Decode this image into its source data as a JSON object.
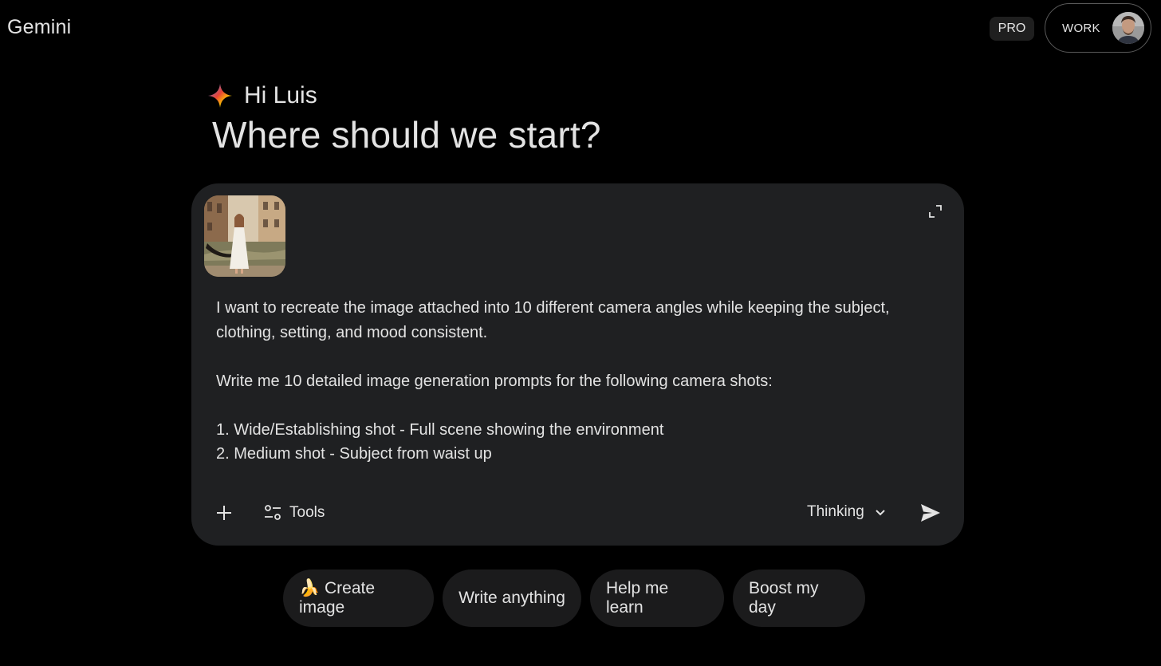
{
  "header": {
    "app_title": "Gemini",
    "plan_badge": "PRO",
    "account_label": "WORK"
  },
  "greeting": {
    "hello": "Hi Luis",
    "headline": "Where should we start?"
  },
  "prompt": {
    "lines": [
      "I want to recreate the image attached into 10 different camera angles while keeping the subject, clothing, setting, and mood consistent.",
      "",
      "Write me 10 detailed image generation prompts for the following camera shots:",
      "",
      "1. Wide/Establishing shot - Full scene showing the environment",
      "2. Medium shot - Subject from waist up"
    ],
    "tools_label": "Tools",
    "mode_label": "Thinking"
  },
  "suggestions": [
    {
      "label": "🍌 Create image"
    },
    {
      "label": "Write anything"
    },
    {
      "label": "Help me learn"
    },
    {
      "label": "Boost my day"
    }
  ],
  "icons": {
    "spark": "gemini-spark-icon",
    "expand": "expand-icon",
    "add": "plus-icon",
    "tools": "tools-icon",
    "chevron": "chevron-down-icon",
    "send": "send-icon"
  },
  "colors": {
    "background": "#000000",
    "prompt_box": "#1f2022",
    "chip": "#1b1b1c",
    "text": "#e3e3e3"
  }
}
